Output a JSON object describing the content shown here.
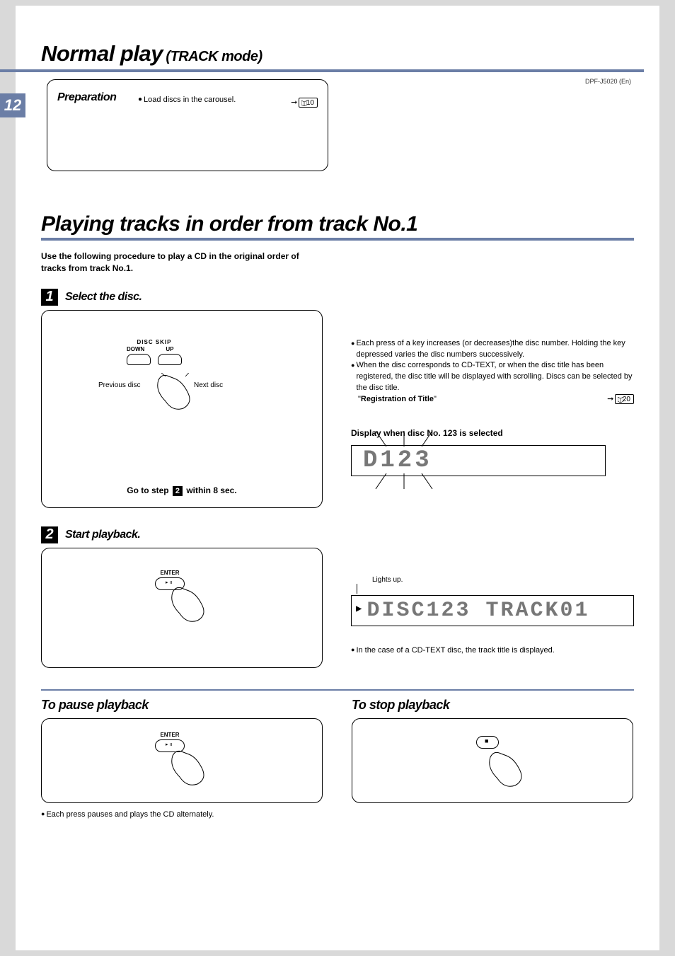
{
  "header": {
    "title_main": "Normal play",
    "title_sub": "(TRACK mode)",
    "model": "DPF-J5020 (En)",
    "page_number": "12"
  },
  "preparation": {
    "title": "Preparation",
    "bullet": "Load discs in the carousel.",
    "page_ref": "10"
  },
  "section": {
    "title": "Playing tracks in order from track No.1",
    "intro": "Use the following procedure to play a CD in the original order of tracks from track No.1."
  },
  "step1": {
    "badge": "1",
    "title": "Select the disc.",
    "disc_skip_label": "DISC SKIP",
    "down_label": "DOWN",
    "up_label": "UP",
    "prev_disc": "Previous disc",
    "next_disc": "Next disc",
    "go_to_step_pre": "Go to step",
    "go_to_step_num": "2",
    "go_to_step_post": "within 8 sec.",
    "notes": {
      "n1": "Each press of a key increases (or decreases)the disc number. Holding the key depressed varies the disc numbers successively.",
      "n2": "When the disc corresponds to CD-TEXT, or when the disc title has been registered, the disc title will be displayed with scrolling. Discs can be selected by the disc title.",
      "reg_title_pre": "\"",
      "reg_title": "Registration of Title",
      "reg_title_post": "\"",
      "page_ref": "20"
    },
    "display_header": "Display when disc No. 123 is selected",
    "display_value": "D123"
  },
  "step2": {
    "badge": "2",
    "title": "Start playback.",
    "enter_label": "ENTER",
    "lights_up": "Lights up.",
    "display_value": "DISC123  TRACK01",
    "cdtext_note": "In the case of a CD-TEXT disc, the track title is displayed."
  },
  "pause": {
    "title": "To pause playback",
    "enter_label": "ENTER",
    "note": "Each press pauses and plays the CD alternately."
  },
  "stop": {
    "title": "To stop playback"
  }
}
